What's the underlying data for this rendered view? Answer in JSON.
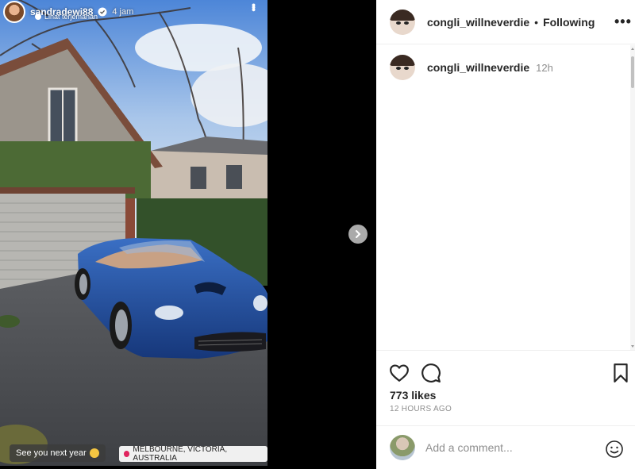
{
  "story": {
    "username": "sandradewi88",
    "time": "4 jam",
    "translate_label": "Lihat terjemahan",
    "caption": "See you next year",
    "location": "MELBOURNE, VICTORIA, AUSTRALIA"
  },
  "post": {
    "author": "congli_willneverdie",
    "follow_status": "Following",
    "separator": "•",
    "caption_time": "12h",
    "likes": "773 likes",
    "posted": "12 HOURS AGO"
  },
  "comment_box": {
    "placeholder": "Add a comment..."
  },
  "icons": {
    "like": "heart-icon",
    "comment": "comment-icon",
    "save": "bookmark-icon",
    "next": "chevron-right-icon",
    "more": "more-options-icon",
    "emoji": "emoji-icon"
  },
  "colors": {
    "text": "#262626",
    "secondary": "#8e8e8e",
    "divider": "#efefef",
    "car_blue": "#1f4ea3"
  }
}
